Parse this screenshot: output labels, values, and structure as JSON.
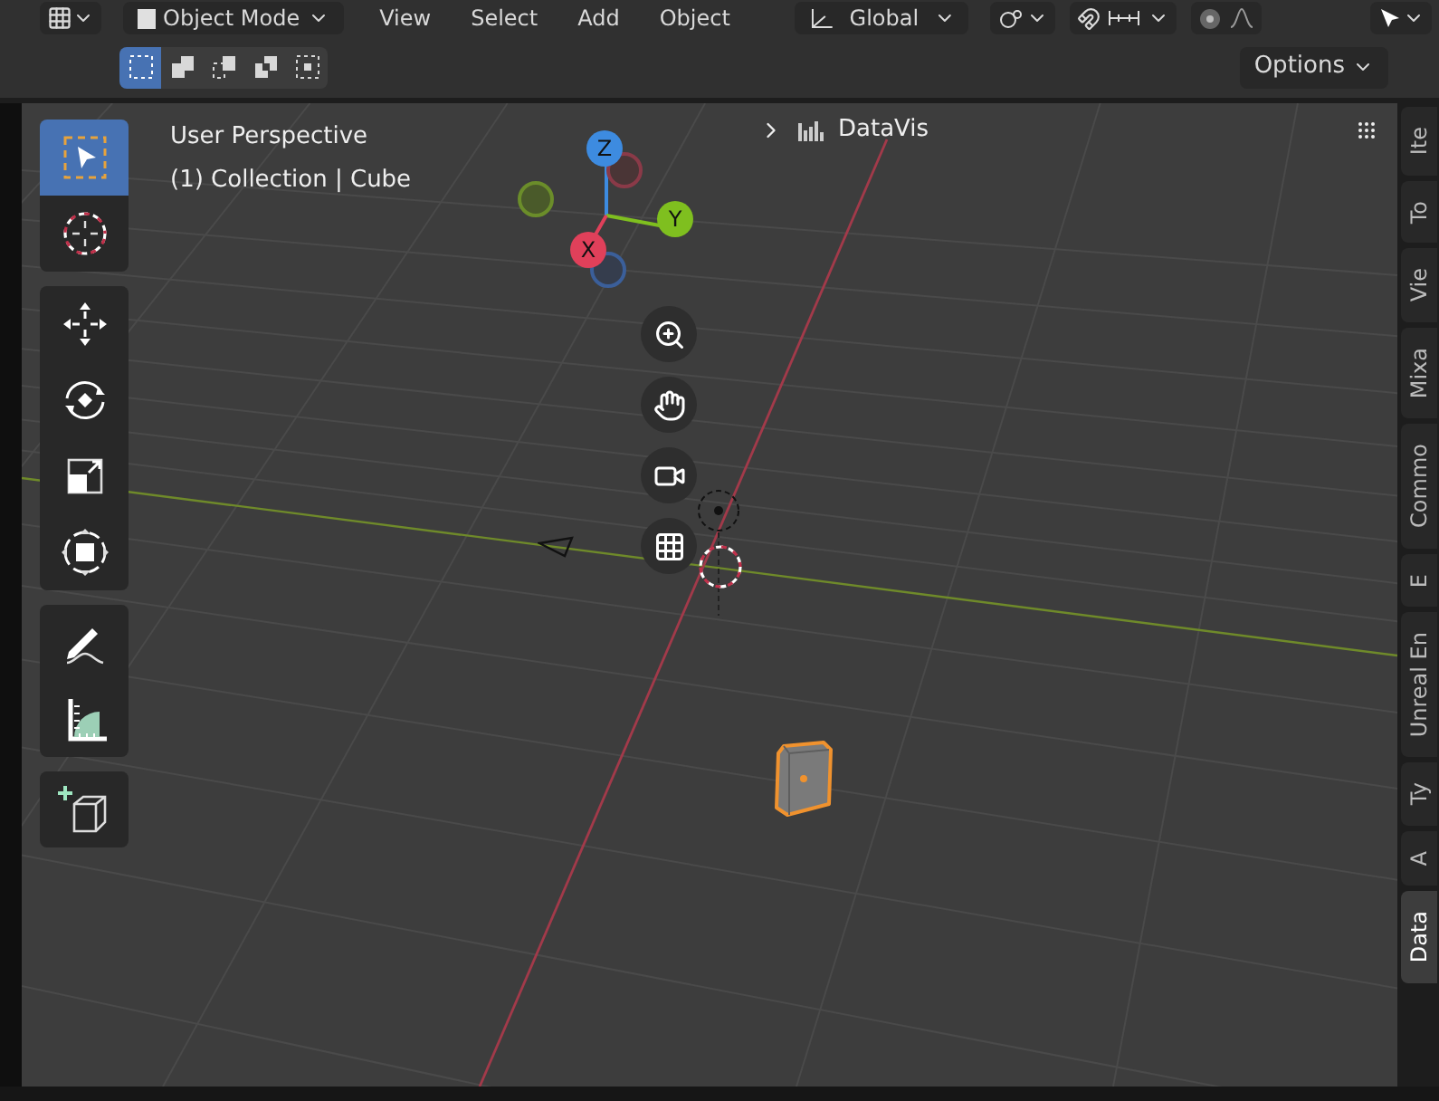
{
  "header": {
    "mode": "Object Mode",
    "menus": [
      "View",
      "Select",
      "Add",
      "Object"
    ],
    "orientation": "Global"
  },
  "selection_modes": [
    {
      "kind": "new",
      "selected": true
    },
    {
      "kind": "extend",
      "selected": false
    },
    {
      "kind": "subtract",
      "selected": false
    },
    {
      "kind": "difference",
      "selected": false
    },
    {
      "kind": "intersect",
      "selected": false
    }
  ],
  "options": "Options",
  "viewport": {
    "title": "User Perspective",
    "subtitle": "(1) Collection | Cube"
  },
  "gizmo": {
    "x": "X",
    "y": "Y",
    "z": "Z"
  },
  "panel": {
    "title": "DataVis",
    "expanded": false
  },
  "toolbar": [
    {
      "tools": [
        {
          "kind": "select",
          "selected": true
        },
        {
          "kind": "cursor",
          "selected": false
        }
      ]
    },
    {
      "tools": [
        {
          "kind": "move",
          "selected": false
        },
        {
          "kind": "rotate",
          "selected": false
        },
        {
          "kind": "scale",
          "selected": false
        },
        {
          "kind": "transform",
          "selected": false
        }
      ]
    },
    {
      "tools": [
        {
          "kind": "annotate",
          "selected": false
        },
        {
          "kind": "measure",
          "selected": false
        }
      ]
    },
    {
      "tools": [
        {
          "kind": "add-cube",
          "selected": false
        }
      ]
    }
  ],
  "tabs": [
    {
      "label": "Ite",
      "selected": false
    },
    {
      "label": "To",
      "selected": false
    },
    {
      "label": "Vie",
      "selected": false
    },
    {
      "label": "Mixa",
      "selected": false
    },
    {
      "label": "Commo",
      "selected": false
    },
    {
      "label": "E",
      "selected": false
    },
    {
      "label": "Unreal En",
      "selected": false
    },
    {
      "label": "Ty",
      "selected": false
    },
    {
      "label": "A",
      "selected": false
    },
    {
      "label": "Data",
      "selected": true
    }
  ]
}
